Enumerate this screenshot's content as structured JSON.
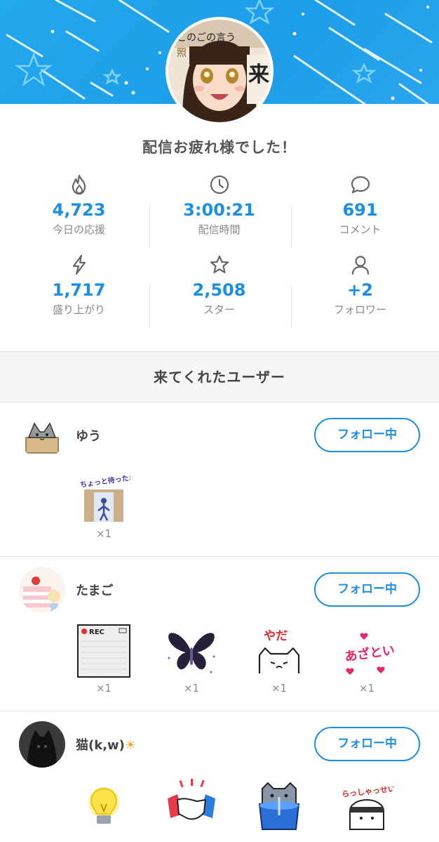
{
  "header": {
    "title": "配信お疲れ様でした！",
    "avatar_caption_1": "このごの言う",
    "avatar_caption_2": "来",
    "avatar_caption_3": "照"
  },
  "stats": [
    {
      "icon": "flame-icon",
      "value": "4,723",
      "label": "今日の応援"
    },
    {
      "icon": "clock-icon",
      "value": "3:00:21",
      "label": "配信時間"
    },
    {
      "icon": "comment-icon",
      "value": "691",
      "label": "コメント"
    },
    {
      "icon": "lightning-icon",
      "value": "1,717",
      "label": "盛り上がり"
    },
    {
      "icon": "star-icon",
      "value": "2,508",
      "label": "スター"
    },
    {
      "icon": "person-icon",
      "value": "+2",
      "label": "フォロワー"
    }
  ],
  "visitors_heading": "来てくれたユーザー",
  "users": [
    {
      "name": "ゆう",
      "follow_label": "フォロー中",
      "gifts": [
        {
          "name": "door-sticker",
          "text": "ちょっと待ったぁぁ!!",
          "count": "×1"
        }
      ]
    },
    {
      "name": "たまご",
      "follow_label": "フォロー中",
      "gifts": [
        {
          "name": "rec-sticker",
          "text": "REC",
          "count": "×1"
        },
        {
          "name": "butterfly-sticker",
          "count": "×1"
        },
        {
          "name": "yada-cat-sticker",
          "text": "やだ",
          "count": "×1"
        },
        {
          "name": "azatoi-sticker",
          "text": "あざとい",
          "count": "×1"
        }
      ]
    },
    {
      "name": "猫(k,w)",
      "name_suffix": "☀",
      "follow_label": "フォロー中",
      "gifts": [
        {
          "name": "lightbulb-sticker"
        },
        {
          "name": "handshake-sticker"
        },
        {
          "name": "cat-cup-sticker"
        },
        {
          "name": "irasshai-sticker",
          "text": "らっしゃっせい!"
        }
      ]
    }
  ],
  "colors": {
    "accent": "#1c8fe0",
    "banner": "#22a8ee"
  }
}
